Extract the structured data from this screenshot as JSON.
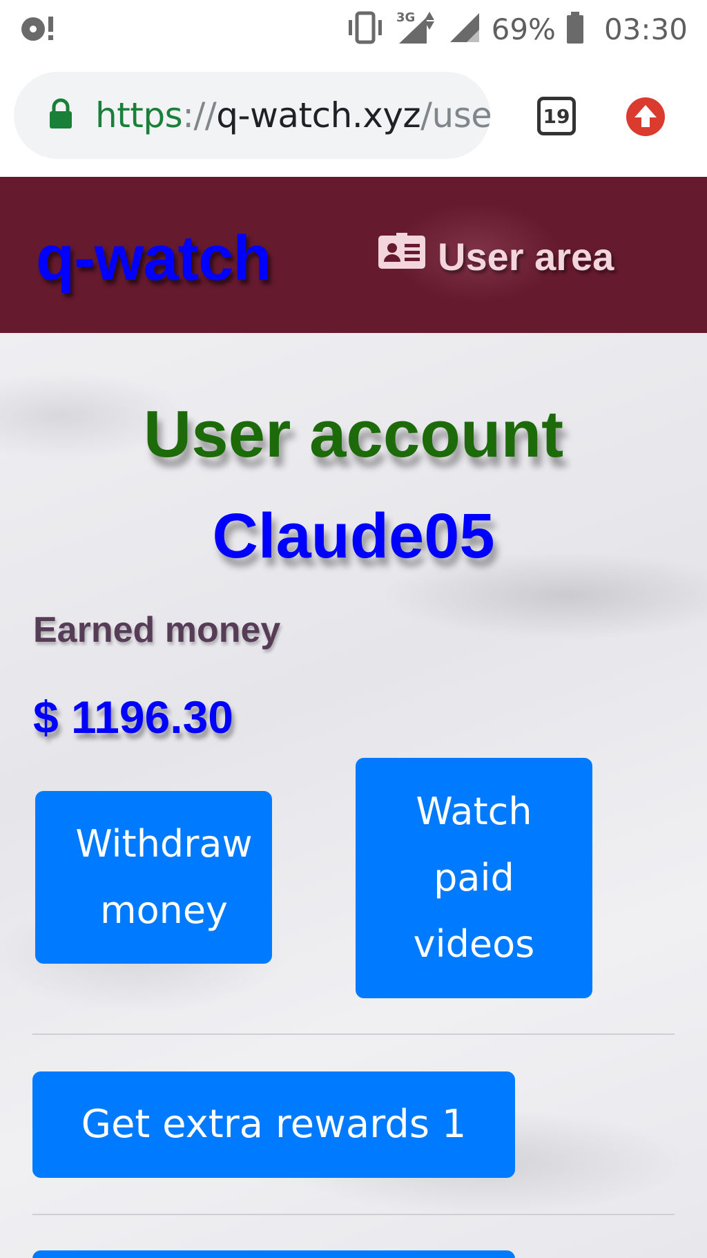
{
  "status_bar": {
    "battery_percent": "69%",
    "time": "03:30",
    "network_label": "3G"
  },
  "browser": {
    "url_scheme": "https",
    "url_separator": "://",
    "url_host": "q-watch.xyz",
    "url_path": "/user",
    "tab_count": "19"
  },
  "header": {
    "brand": "q-watch",
    "user_area_label": "User area"
  },
  "account": {
    "title": "User account",
    "username": "Claude05",
    "earned_label": "Earned money",
    "earned_value": "$ 1196.30"
  },
  "buttons": {
    "withdraw_line1": "Withdraw",
    "withdraw_line2": "money",
    "watch_line1": "Watch",
    "watch_line2": "paid",
    "watch_line3": "videos",
    "extra_rewards": "Get extra rewards 1"
  },
  "colors": {
    "header_bg": "#661a2d",
    "brand_blue": "#0000ff",
    "title_green": "#1c6a0a",
    "button_blue": "#007bff"
  }
}
